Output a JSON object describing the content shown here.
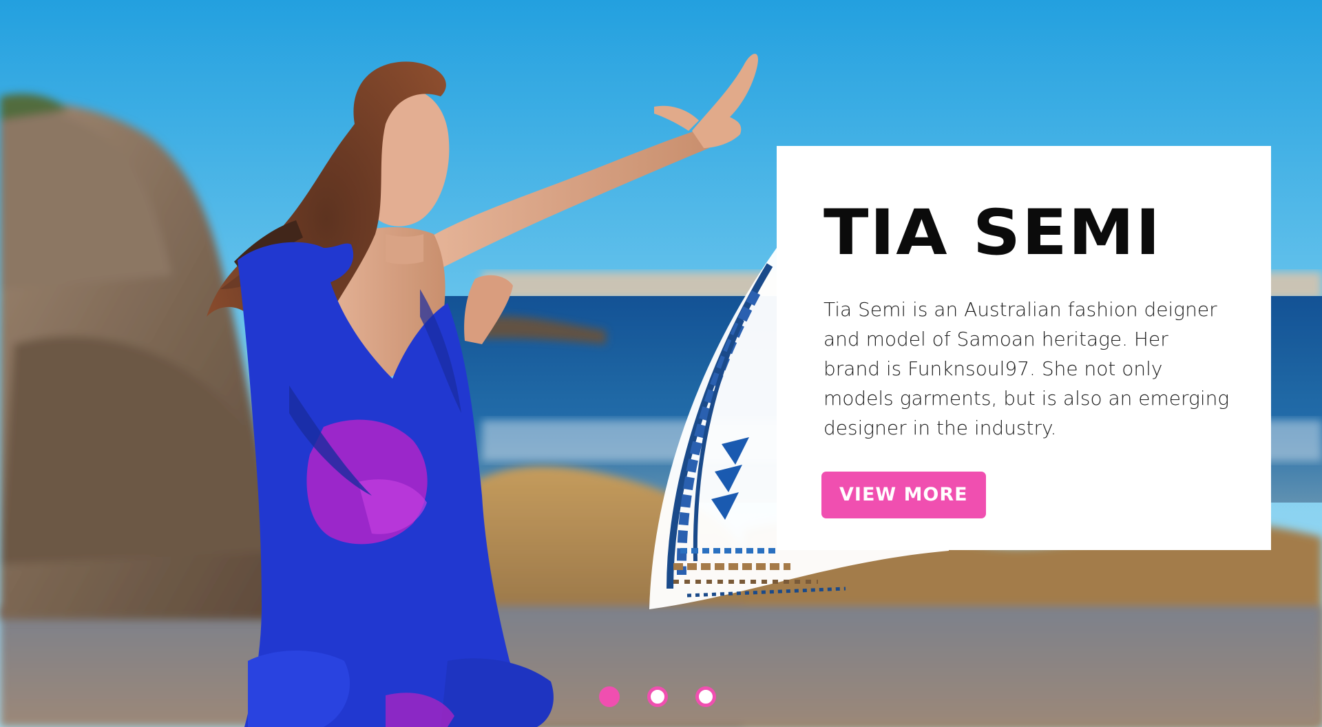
{
  "hero": {
    "title": "TIA SEMI",
    "description": "Tia Semi is an Australian fashion deigner and model of Samoan heritage. Her brand is Funknsoul97. She not only models garments, but is also an emerging designer in the industry.",
    "button_label": "VIEW MORE"
  },
  "carousel": {
    "slide_count": 3,
    "active_index": 0
  },
  "colors": {
    "accent": "#f04fb0",
    "panel_bg": "#ffffff",
    "title_text": "#0b0b0b",
    "sky": "#3aa6dd",
    "dress": "#1d35d0",
    "dress_print": "#b020c8"
  }
}
